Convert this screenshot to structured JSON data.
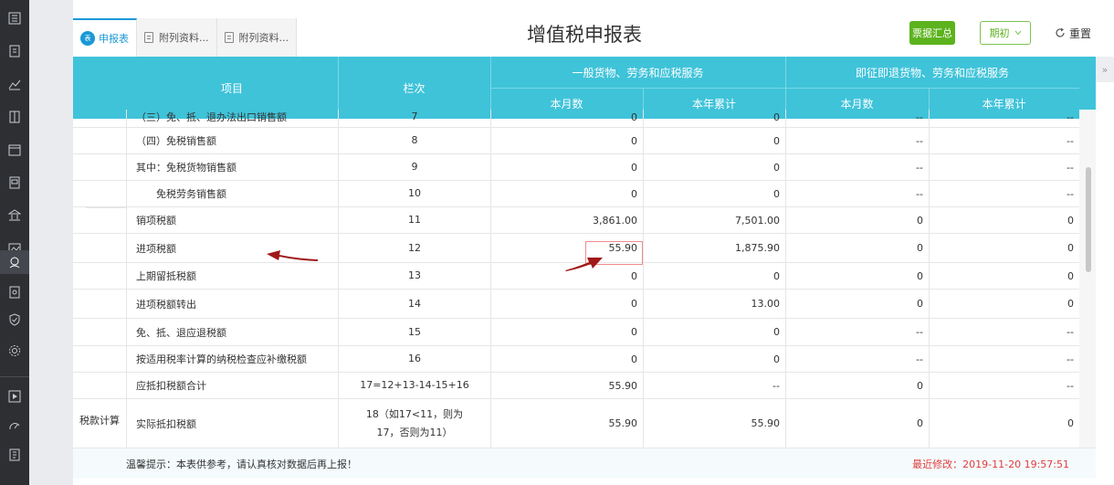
{
  "tabs": [
    {
      "label": "申报表",
      "icon_text": "表"
    },
    {
      "label": "附列资料..."
    },
    {
      "label": "附列资料..."
    }
  ],
  "page_title": "增值税申报表",
  "toolbar": {
    "summary_button": "票据汇总",
    "period_button": "期初",
    "reset_button": "重置"
  },
  "table_header": {
    "item": "项目",
    "column": "栏次",
    "group1": "一般货物、劳务和应税服务",
    "group2": "即征即退货物、劳务和应税服务",
    "monthly": "本月数",
    "cumulative": "本年累计"
  },
  "category": "税款计算",
  "rows": [
    {
      "item": "（三）免、抵、退办法出口销售额",
      "col": "7",
      "v1": "0",
      "v2": "0",
      "v3": "--",
      "v4": "--"
    },
    {
      "item": "（四）免税销售额",
      "col": "8",
      "v1": "0",
      "v2": "0",
      "v3": "--",
      "v4": "--"
    },
    {
      "item": "其中：免税货物销售额",
      "col": "9",
      "v1": "0",
      "v2": "0",
      "v3": "--",
      "v4": "--"
    },
    {
      "item": "免税劳务销售额",
      "col": "10",
      "v1": "0",
      "v2": "0",
      "v3": "--",
      "v4": "--"
    },
    {
      "item": "销项税额",
      "col": "11",
      "v1": "3,861.00",
      "v2": "7,501.00",
      "v3": "0",
      "v4": "0"
    },
    {
      "item": "进项税额",
      "col": "12",
      "v1": "55.90",
      "v2": "1,875.90",
      "v3": "0",
      "v4": "0"
    },
    {
      "item": "上期留抵税额",
      "col": "13",
      "v1": "0",
      "v2": "0",
      "v3": "0",
      "v4": "0"
    },
    {
      "item": "进项税额转出",
      "col": "14",
      "v1": "0",
      "v2": "13.00",
      "v3": "0",
      "v4": "0"
    },
    {
      "item": "免、抵、退应退税额",
      "col": "15",
      "v1": "0",
      "v2": "0",
      "v3": "--",
      "v4": "--"
    },
    {
      "item": "按适用税率计算的纳税检查应补缴税额",
      "col": "16",
      "v1": "0",
      "v2": "0",
      "v3": "--",
      "v4": "--"
    },
    {
      "item": "应抵扣税额合计",
      "col": "17=12+13-14-15+16",
      "v1": "55.90",
      "v2": "--",
      "v3": "0",
      "v4": "--"
    },
    {
      "item": "实际抵扣税额",
      "col": "18（如17<11，则为17，否则为11）",
      "v1": "55.90",
      "v2": "55.90",
      "v3": "0",
      "v4": "0"
    }
  ],
  "footer": {
    "tip": "温馨提示：本表供参考，请认真核对数据后再上报！",
    "last_modified": "最近修改：2019-11-20 19:57:51"
  },
  "colors": {
    "header": "#3fc3d9",
    "accent_green": "#5cb31d",
    "annotation_red": "#a01818"
  }
}
